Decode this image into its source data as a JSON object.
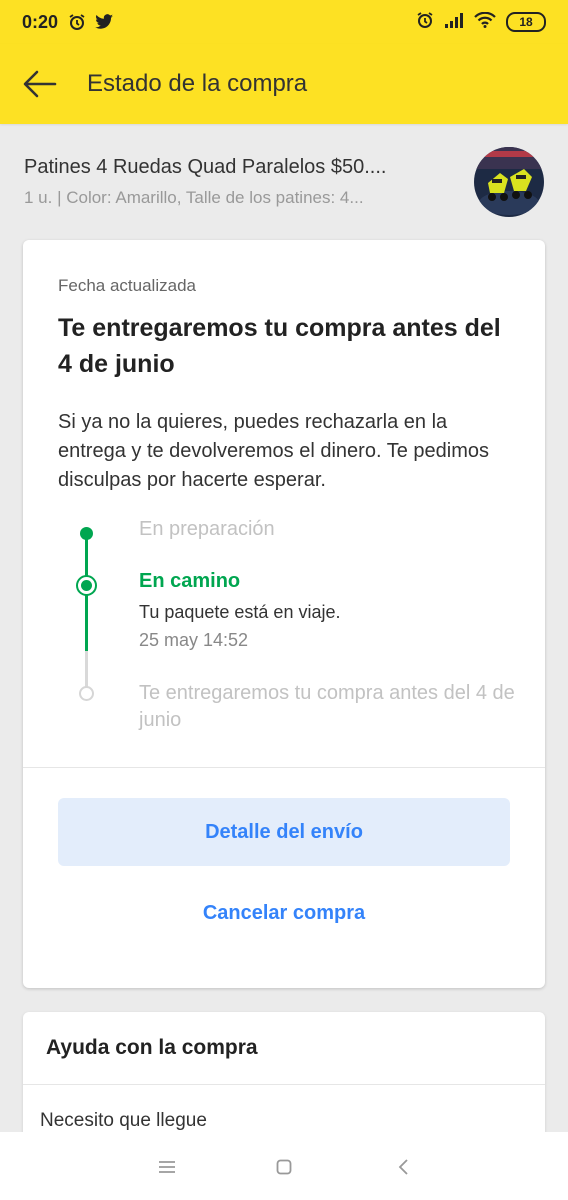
{
  "status_bar": {
    "time": "0:20",
    "battery": "18"
  },
  "app_bar": {
    "title": "Estado de la compra"
  },
  "product": {
    "name": "Patines 4 Ruedas Quad Paralelos $50....",
    "details": "1 u. | Color: Amarillo, Talle de los patines: 4..."
  },
  "status_card": {
    "label": "Fecha actualizada",
    "headline": "Te entregaremos tu compra antes del 4 de junio",
    "body": "Si ya no la quieres, puedes rechazarla en la entrega y te devolveremos el dinero. Te pedimos disculpas por hacerte esperar.",
    "timeline": [
      {
        "title": "En preparación"
      },
      {
        "title": "En camino",
        "subtitle": "Tu paquete está en viaje.",
        "time": "25 may 14:52"
      },
      {
        "title": "Te entregaremos tu compra antes del 4 de junio"
      }
    ],
    "primary_button": "Detalle del envío",
    "secondary_button": "Cancelar compra"
  },
  "help": {
    "title": "Ayuda con la compra",
    "items": [
      "Necesito que llegue"
    ]
  },
  "colors": {
    "brand_yellow": "#fde123",
    "accent_blue": "#3483fa",
    "success_green": "#00a650"
  }
}
